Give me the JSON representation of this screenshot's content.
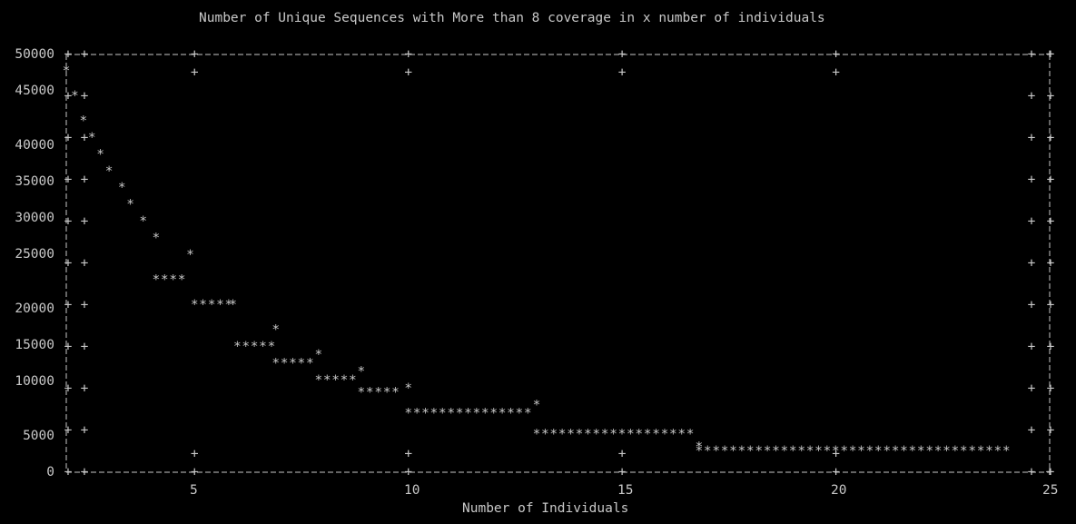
{
  "chart_data": {
    "type": "scatter",
    "title": "Number of Unique Sequences with More than 8 coverage in x number of individuals",
    "xlabel": "Number of Individuals",
    "ylabel": "",
    "xlim": [
      2,
      25
    ],
    "ylim": [
      0,
      50000
    ],
    "xticks": [
      "5",
      "10",
      "15",
      "20",
      "25"
    ],
    "yticks": [
      "50000",
      "45000",
      "40000",
      "35000",
      "30000",
      "25000",
      "20000",
      "15000",
      "10000",
      "5000",
      "0"
    ],
    "grid": false,
    "marker": "*",
    "x": [
      2,
      2.2,
      2.4,
      2.6,
      2.8,
      3.0,
      3.3,
      3.5,
      3.8,
      4.1,
      4.9,
      5.9,
      6.9,
      7.9,
      8.9,
      10.0,
      13.0,
      16.8
    ],
    "y": [
      48000,
      45000,
      42000,
      40000,
      38000,
      36000,
      34000,
      32000,
      30000,
      28000,
      26000,
      20000,
      17000,
      14000,
      12000,
      10000,
      8000,
      3000
    ],
    "runs": [
      {
        "x_start": 4.1,
        "x_end": 4.8,
        "y": 23000
      },
      {
        "x_start": 5.0,
        "x_end": 5.8,
        "y": 20000
      },
      {
        "x_start": 6.0,
        "x_end": 6.8,
        "y": 15000
      },
      {
        "x_start": 6.9,
        "x_end": 7.8,
        "y": 13000
      },
      {
        "x_start": 7.9,
        "x_end": 8.8,
        "y": 11000
      },
      {
        "x_start": 8.9,
        "x_end": 9.8,
        "y": 9500
      },
      {
        "x_start": 10.0,
        "x_end": 12.8,
        "y": 7000
      },
      {
        "x_start": 13.0,
        "x_end": 16.7,
        "y": 4500
      },
      {
        "x_start": 16.8,
        "x_end": 24.0,
        "y": 2500
      }
    ]
  }
}
